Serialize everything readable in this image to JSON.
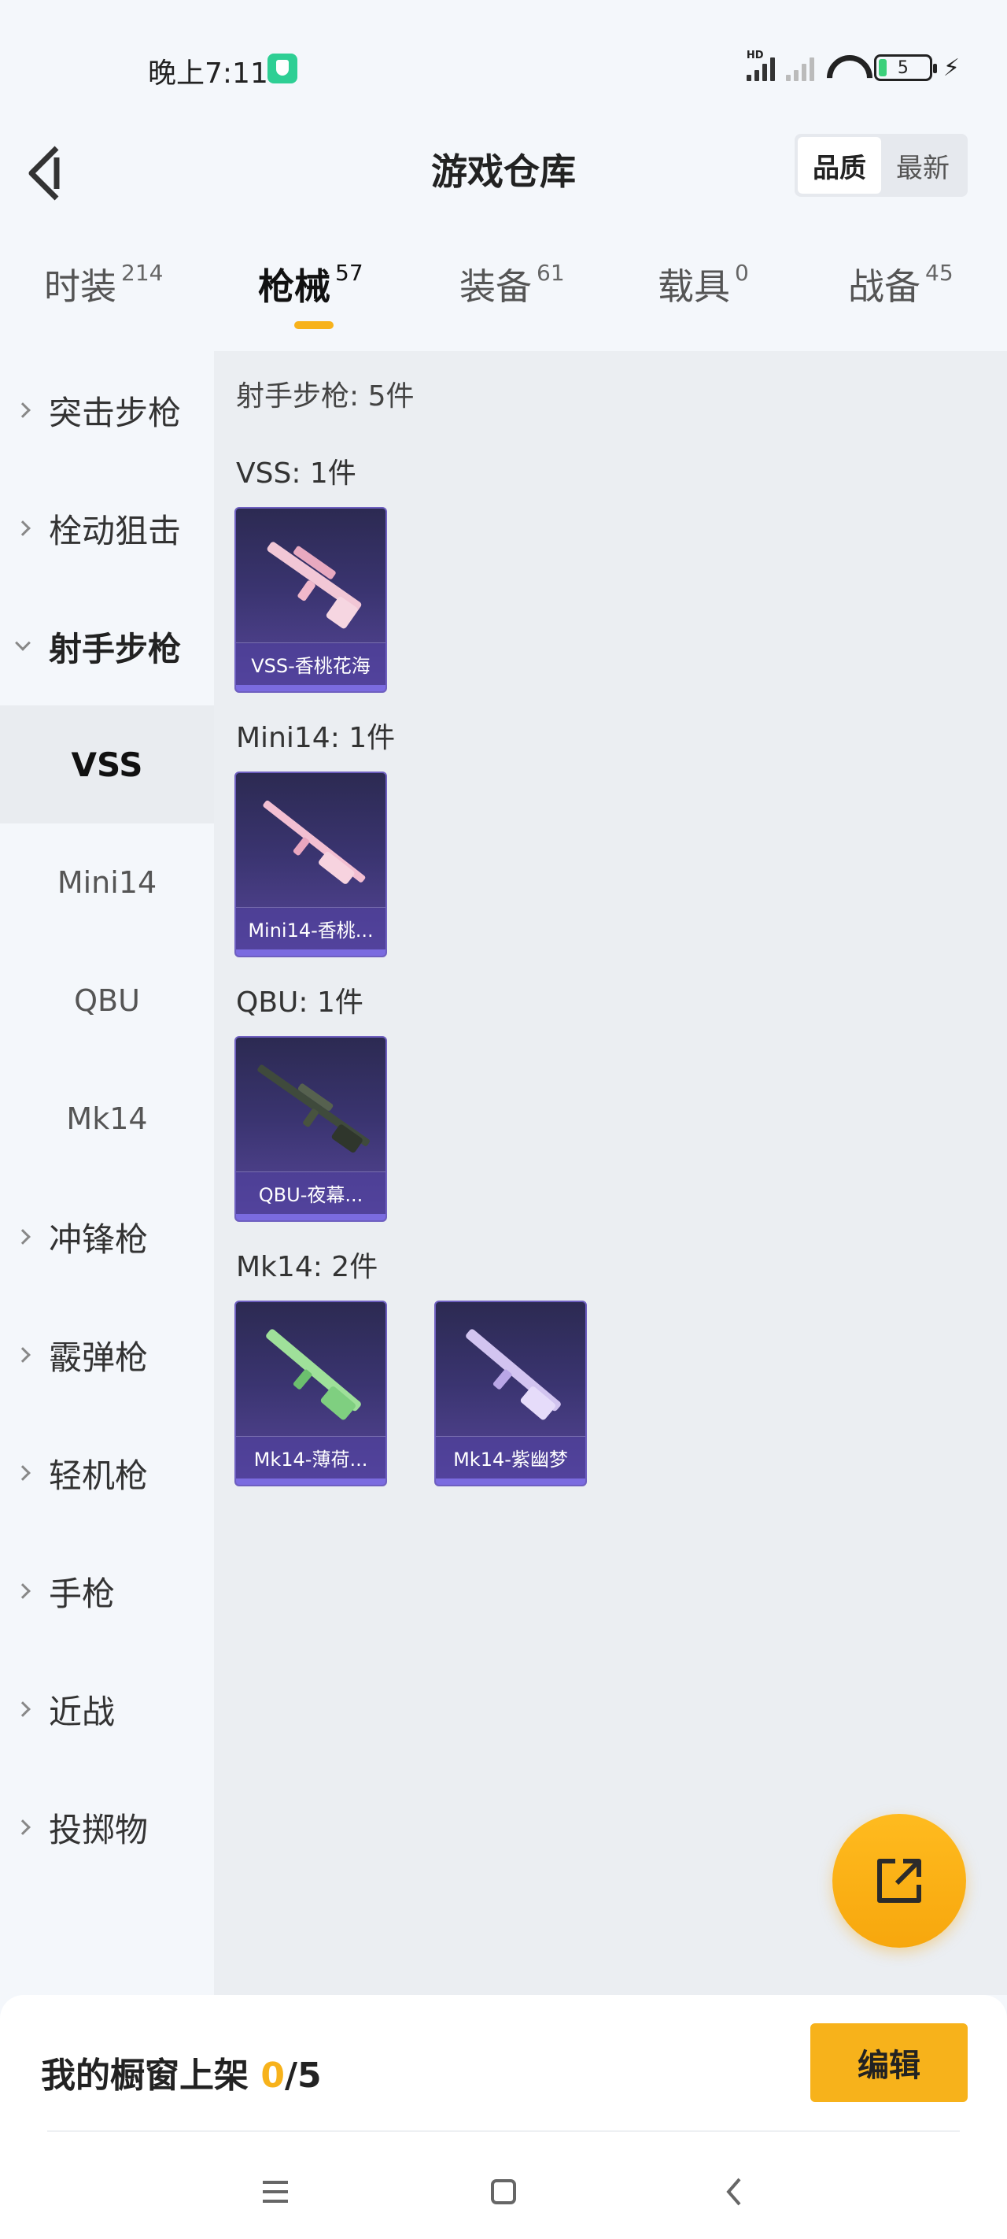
{
  "status": {
    "time": "晚上7:11",
    "battery": "5",
    "hd": "HD"
  },
  "header": {
    "title": "游戏仓库",
    "sort": [
      "品质",
      "最新"
    ]
  },
  "tabs": [
    {
      "label": "时装",
      "count": "214"
    },
    {
      "label": "枪械",
      "count": "57"
    },
    {
      "label": "装备",
      "count": "61"
    },
    {
      "label": "载具",
      "count": "0"
    },
    {
      "label": "战备",
      "count": "45"
    }
  ],
  "sidebar": {
    "before": [
      "突击步枪",
      "栓动狙击"
    ],
    "open": "射手步枪",
    "subs": [
      "VSS",
      "Mini14",
      "QBU",
      "Mk14"
    ],
    "after": [
      "冲锋枪",
      "霰弹枪",
      "轻机枪",
      "手枪",
      "近战",
      "投掷物"
    ]
  },
  "main": {
    "section_title": "射手步枪: 5件",
    "groups": [
      {
        "title": "VSS: 1件",
        "items": [
          "VSS-香桃花海"
        ]
      },
      {
        "title": "Mini14: 1件",
        "items": [
          "Mini14-香桃..."
        ]
      },
      {
        "title": "QBU: 1件",
        "items": [
          "QBU-夜幕..."
        ]
      },
      {
        "title": "Mk14: 2件",
        "items": [
          "Mk14-薄荷...",
          "Mk14-紫幽梦"
        ]
      }
    ]
  },
  "bottom": {
    "label": "我的橱窗上架 ",
    "count": "0",
    "total": "/5",
    "edit": "编辑"
  },
  "colors": {
    "accent": "#f7b21b",
    "card": "#3a3470"
  },
  "icons": [
    "back-icon",
    "share-icon",
    "menu-icon",
    "home-icon",
    "nav-back-icon"
  ]
}
